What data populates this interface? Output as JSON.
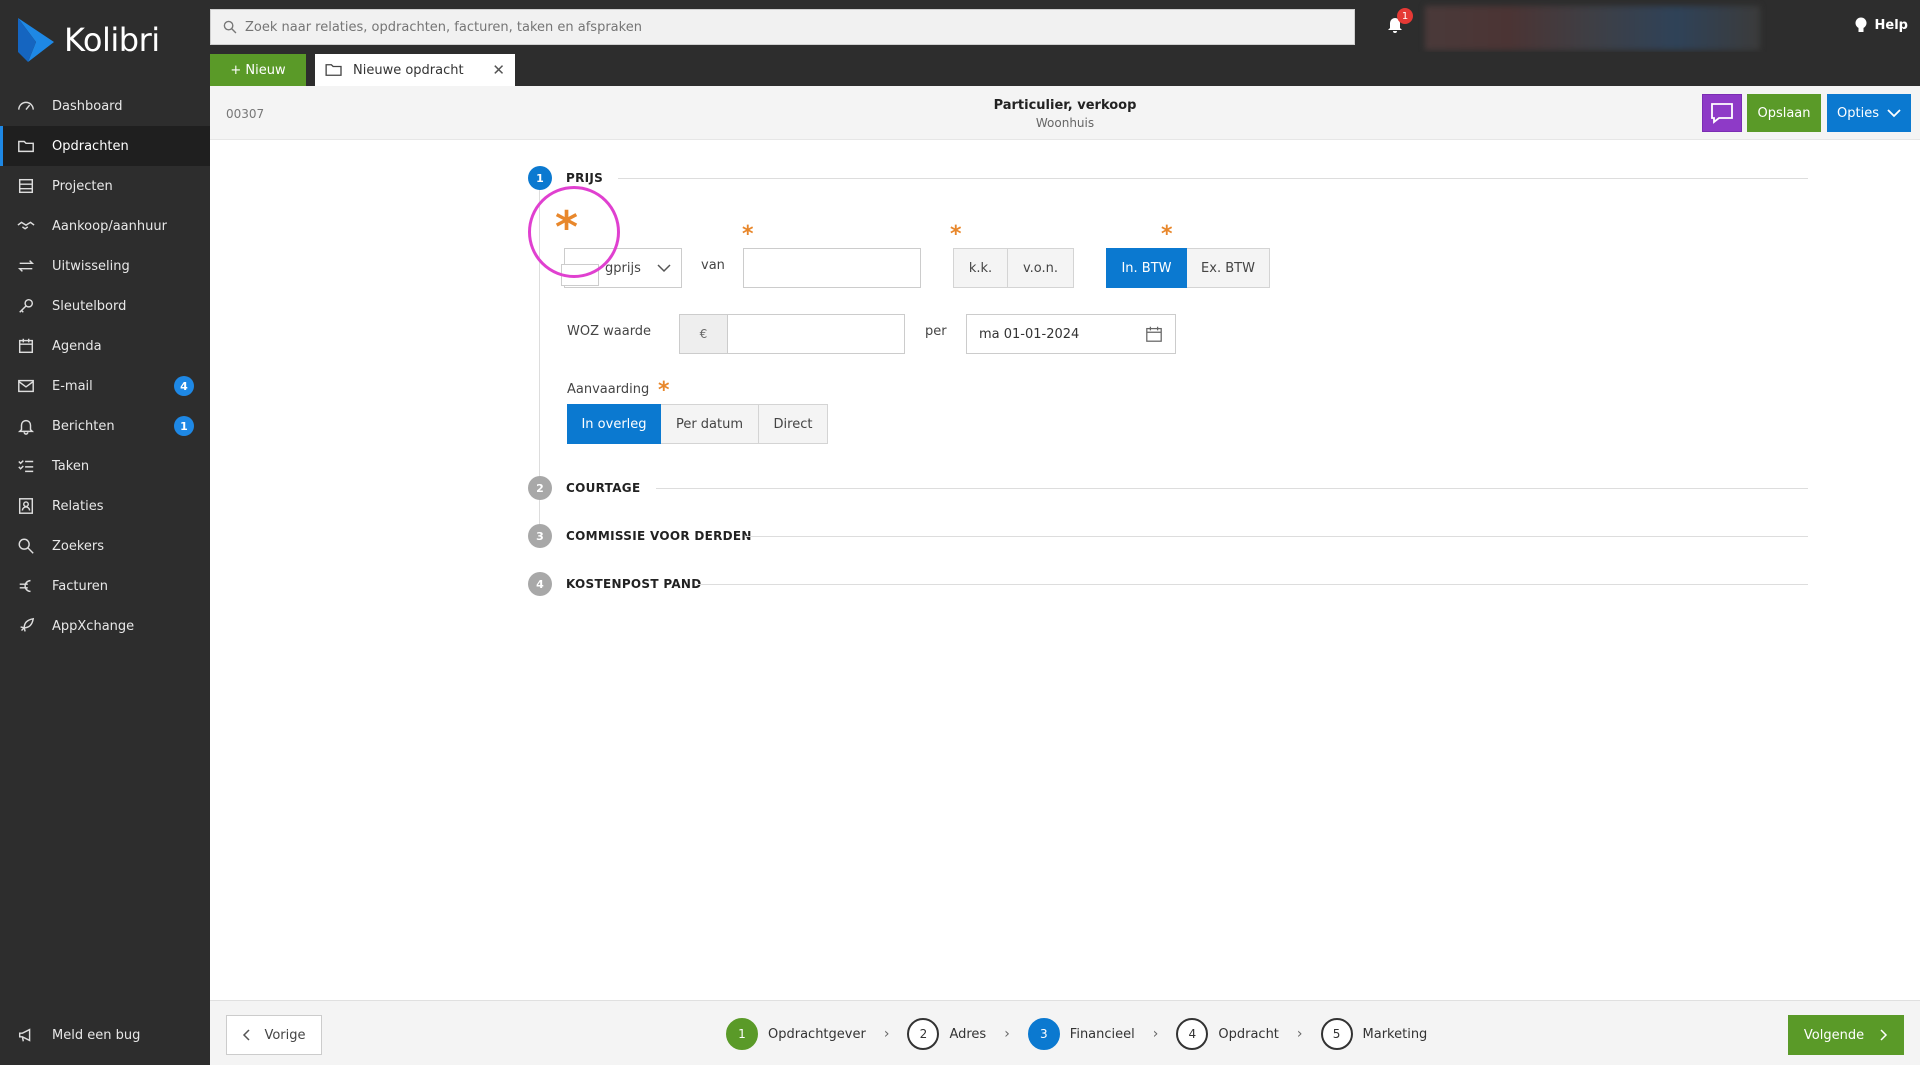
{
  "app": {
    "name": "Kolibri"
  },
  "sidebar": {
    "items": [
      {
        "label": "Dashboard",
        "icon": "dashboard-icon"
      },
      {
        "label": "Opdrachten",
        "icon": "folder-icon",
        "active": true
      },
      {
        "label": "Projecten",
        "icon": "projects-icon"
      },
      {
        "label": "Aankoop/aanhuur",
        "icon": "handshake-icon"
      },
      {
        "label": "Uitwisseling",
        "icon": "exchange-icon"
      },
      {
        "label": "Sleutelbord",
        "icon": "key-icon"
      },
      {
        "label": "Agenda",
        "icon": "calendar-icon"
      },
      {
        "label": "E-mail",
        "icon": "mail-icon",
        "badge": "4"
      },
      {
        "label": "Berichten",
        "icon": "bell-icon",
        "badge": "1"
      },
      {
        "label": "Taken",
        "icon": "tasks-icon"
      },
      {
        "label": "Relaties",
        "icon": "contacts-icon"
      },
      {
        "label": "Zoekers",
        "icon": "search-icon"
      },
      {
        "label": "Facturen",
        "icon": "euro-icon"
      },
      {
        "label": "AppXchange",
        "icon": "rocket-icon"
      }
    ],
    "bug_label": "Meld een bug"
  },
  "topbar": {
    "search_placeholder": "Zoek naar relaties, opdrachten, facturen, taken en afspraken",
    "notification_count": "1",
    "help_label": "Help"
  },
  "tabs": {
    "new_label": "+ Nieuw",
    "open_tab_label": "Nieuwe opdracht"
  },
  "header": {
    "order_number": "00307",
    "title": "Particulier, verkoop",
    "subtitle": "Woonhuis",
    "save_label": "Opslaan",
    "options_label": "Opties"
  },
  "sections": [
    {
      "num": "1",
      "title": "PRIJS",
      "active": true
    },
    {
      "num": "2",
      "title": "COURTAGE"
    },
    {
      "num": "3",
      "title": "COMMISSIE VOOR DERDEN"
    },
    {
      "num": "4",
      "title": "KOSTENPOST PAND"
    }
  ],
  "prijs": {
    "price_type_value": "gprijs",
    "van_label": "van",
    "price_value": "",
    "kk_options": [
      "k.k.",
      "v.o.n."
    ],
    "btw_options": [
      "In. BTW",
      "Ex. BTW"
    ],
    "btw_selected": "In. BTW",
    "required_mark": "*",
    "woz_label": "WOZ waarde",
    "currency_symbol": "€",
    "woz_value": "",
    "per_label": "per",
    "per_date": "ma 01-01-2024",
    "aanvaarding_label": "Aanvaarding",
    "aanvaarding_options": [
      "In overleg",
      "Per datum",
      "Direct"
    ],
    "aanvaarding_selected": "In overleg"
  },
  "footer": {
    "prev_label": "Vorige",
    "next_label": "Volgende",
    "steps": [
      {
        "num": "1",
        "label": "Opdrachtgever",
        "state": "done"
      },
      {
        "num": "2",
        "label": "Adres",
        "state": "todo"
      },
      {
        "num": "3",
        "label": "Financieel",
        "state": "current"
      },
      {
        "num": "4",
        "label": "Opdracht",
        "state": "todo"
      },
      {
        "num": "5",
        "label": "Marketing",
        "state": "todo"
      }
    ]
  },
  "colors": {
    "accent_blue": "#0b79d0",
    "accent_green": "#5a9a28",
    "required_orange": "#e8872b",
    "highlight_magenta": "#e040d0",
    "chat_purple": "#8e3ac7"
  }
}
